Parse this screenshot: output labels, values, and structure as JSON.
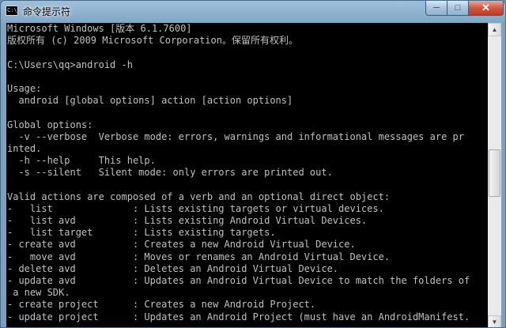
{
  "window": {
    "title": "命令提示符",
    "icon_text": "C:\\",
    "controls": {
      "minimize": "─",
      "maximize": "□",
      "close": "✕"
    }
  },
  "console": {
    "lines": [
      "Microsoft Windows [版本 6.1.7600]",
      "版权所有 (c) 2009 Microsoft Corporation。保留所有权利。",
      "",
      "C:\\Users\\qq>android -h",
      "",
      "Usage:",
      "  android [global options] action [action options]",
      "",
      "Global options:",
      "  -v --verbose  Verbose mode: errors, warnings and informational messages are pr",
      "inted.",
      "  -h --help     This help.",
      "  -s --silent   Silent mode: only errors are printed out.",
      "",
      "Valid actions are composed of a verb and an optional direct object:",
      "-   list              : Lists existing targets or virtual devices.",
      "-   list avd          : Lists existing Android Virtual Devices.",
      "-   list target       : Lists existing targets.",
      "- create avd          : Creates a new Android Virtual Device.",
      "-   move avd          : Moves or renames an Android Virtual Device.",
      "- delete avd          : Deletes an Android Virtual Device.",
      "- update avd          : Updates an Android Virtual Device to match the folders of",
      " a new SDK.",
      "- create project      : Creates a new Android Project.",
      "- update project      : Updates an Android Project (must have an AndroidManifest."
    ]
  },
  "colors": {
    "console_bg": "#000000",
    "console_fg": "#c0c0c0",
    "close_button": "#c2381e"
  }
}
